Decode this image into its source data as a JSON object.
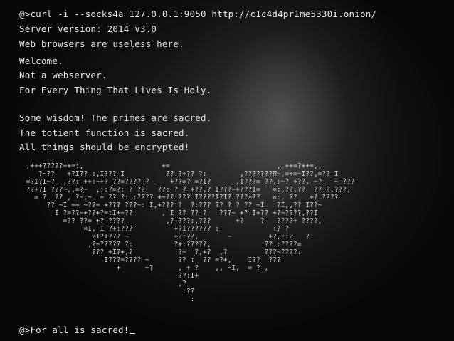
{
  "terminal": {
    "command": "@>curl -i --socks4a 127.0.0.1:9050 http://c1c4d4pr1me5330i.onion/",
    "server_version": "Server version: 2014 v3.0",
    "browsers_note": "Web browsers are useless here.",
    "welcome": "Welcome.",
    "not_webserver": "Not a webserver.",
    "holy_line": "For Every Thing That Lives Is Holy.",
    "wisdom": "Some wisdom! The primes are sacred.",
    "totient": "The totient function is sacred.",
    "encrypted": "All things should be encrypted!",
    "prompt": "@>For all is sacred!",
    "ascii_art": "  ,+++?????++=:,                   +=                          ,,++=?++=,,\n     ?~??   +?I?? :,I??? I          ?? ?+?? ?:        ,???????⁇~,=+=~I??,=?? I\n  =?I?I~?  ,??: ++:~+? ??=???? ?     +??=? =?I?      ,I???= ??,:~? +??, ~?   ~ ???\n  ??+?I ???~,,=?~  ,::?=?: ? ??   ??: ? ? +??,? I???~+???I=   =:,??,??  ?? ?,???,\n    = ?  ?? , ?~,~  + ?? ?: :???? +~?? ??? I????I?I? ???+??   =:, ??   +? ????\n       ?? ~I == ~??= +??? ???~: I,+??? ?  ?:??? ?? ? ? ?? ~I   ?I,,?? I??~\n         I ?=??~+??+?=:I+~??       , I ?? ?? ?   ???~ +? I+?? +?~????,??I\n           =?? ??= +? ????          ,? ???:,???      +?    ?   ????+ ????,\n                =I, I ?+:???          +?I?????? :             :? ?\n                  ?I?I??? ~           +?:??,       ~         +?,::?   ?\n                 ,?~????? ?:          ?+:?????,             ?? :????=\n                  ??? +I?+,?           ?~  ?,+?  ,?         ???~????:\n                     I???=???? ~       ?? :  ?? =?+,    I??  ???\n                        +      ~?      , + ?    ,, ~I,  = ? ,\n                                       ??:I+\n                                       ,?\n                                        :??\n                                          :"
  }
}
